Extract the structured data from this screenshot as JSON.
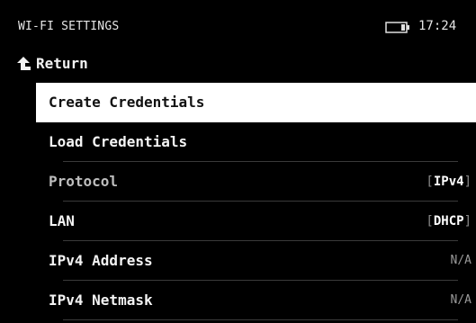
{
  "status_bar": {
    "title": "WI-FI SETTINGS",
    "battery_icon": "battery-icon",
    "time": "17:24"
  },
  "nav": {
    "return_icon": "return-arrow-icon",
    "return_label": "Return"
  },
  "menu": {
    "selected_index": 0,
    "items": [
      {
        "label": "Create Credentials",
        "value": ""
      },
      {
        "label": "Load Credentials",
        "value": ""
      },
      {
        "label": "Protocol",
        "value": "IPv4",
        "bracketed": true
      },
      {
        "label": "LAN",
        "value": "DHCP",
        "bracketed": true
      },
      {
        "label": "IPv4 Address",
        "value": "N/A"
      },
      {
        "label": "IPv4 Netmask",
        "value": "N/A"
      }
    ]
  },
  "colors": {
    "background": "#000000",
    "text": "#f2f2f2",
    "selected_bg": "#ffffff",
    "selected_text": "#111111",
    "divider": "#3a3a3a"
  }
}
